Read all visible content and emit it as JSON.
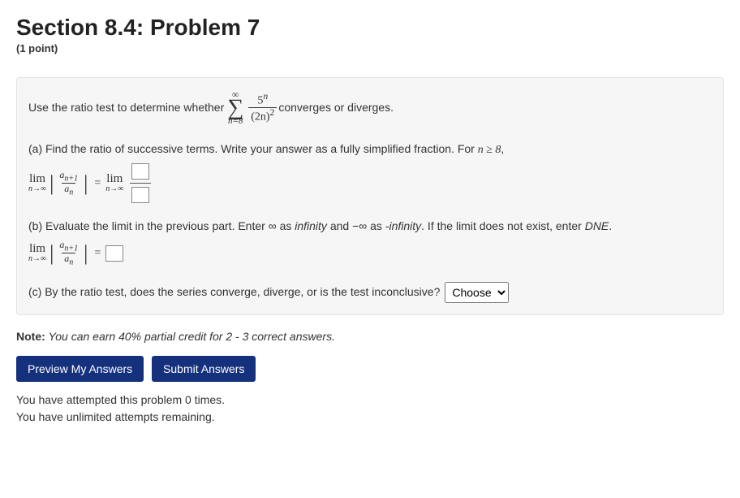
{
  "header": {
    "title": "Section 8.4: Problem 7",
    "points": "(1 point)"
  },
  "problem": {
    "intro_before": "Use the ratio test to determine whether ",
    "series": {
      "top": "∞",
      "bottom": "n=8",
      "num": "5",
      "num_exp": "n",
      "den": "(2n)",
      "den_exp": "2"
    },
    "intro_after": " converges or diverges.",
    "part_a": {
      "prompt_before": "(a) Find the ratio of successive terms. Write your answer as a fully simplified fraction. For ",
      "cond": "n ≥ 8",
      "prompt_after": ",",
      "lim_word": "lim",
      "lim_sub": "n→∞",
      "ratio_num": "a",
      "ratio_num_sub": "n+1",
      "ratio_den": "a",
      "ratio_den_sub": "n"
    },
    "part_b": {
      "prompt_before": "(b) Evaluate the limit in the previous part. Enter ∞ as ",
      "inf_word": "infinity",
      "prompt_mid": " and −∞ as ",
      "neg_inf_word": "-infinity",
      "prompt_mid2": ". If the limit does not exist, enter ",
      "dne_word": "DNE",
      "prompt_after": "."
    },
    "part_c": {
      "prompt": "(c) By the ratio test, does the series converge, diverge, or is the test inconclusive?",
      "select_default": "Choose"
    }
  },
  "note": {
    "label": "Note:",
    "text": "You can earn 40% partial credit for 2 - 3 correct answers."
  },
  "buttons": {
    "preview": "Preview My Answers",
    "submit": "Submit Answers"
  },
  "attempts": {
    "line1": "You have attempted this problem 0 times.",
    "line2": "You have unlimited attempts remaining."
  }
}
